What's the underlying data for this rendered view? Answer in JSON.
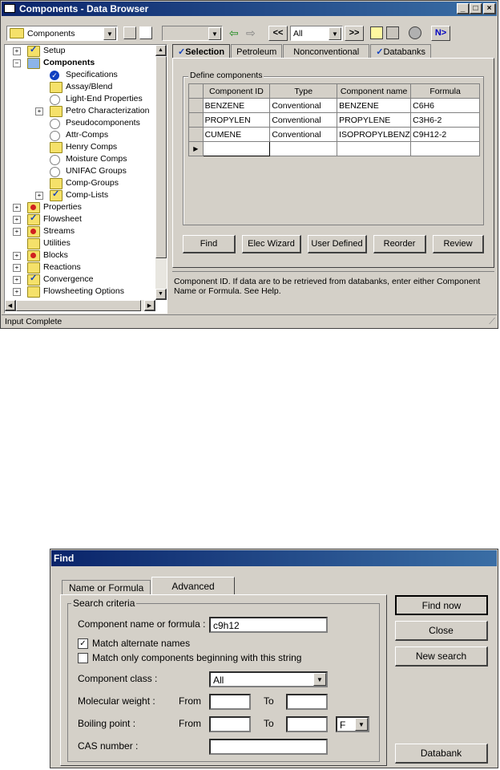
{
  "browser": {
    "title": "Components - Data Browser",
    "window_controls": [
      "_",
      "□",
      "×"
    ],
    "toolbar": {
      "form_select": "Components",
      "nav_select": "All",
      "prev_label": "<<",
      "next_label": ">>",
      "next_form_label": "N>"
    },
    "tree": [
      {
        "label": "Setup",
        "level": 0,
        "expander": "+",
        "icon": "check-folder-icon",
        "bold": false
      },
      {
        "label": "Components",
        "level": 0,
        "expander": "−",
        "icon": "components-folder-icon",
        "bold": true
      },
      {
        "label": "Specifications",
        "level": 1,
        "expander": "",
        "icon": "check-circle-icon",
        "bold": false
      },
      {
        "label": "Assay/Blend",
        "level": 1,
        "expander": "",
        "icon": "folder-icon",
        "bold": false
      },
      {
        "label": "Light-End Properties",
        "level": 1,
        "expander": "",
        "icon": "empty-circle-icon",
        "bold": false
      },
      {
        "label": "Petro Characterization",
        "level": 1,
        "expander": "+",
        "icon": "folder-icon",
        "bold": false
      },
      {
        "label": "Pseudocomponents",
        "level": 1,
        "expander": "",
        "icon": "empty-circle-icon",
        "bold": false
      },
      {
        "label": "Attr-Comps",
        "level": 1,
        "expander": "",
        "icon": "empty-circle-icon",
        "bold": false
      },
      {
        "label": "Henry Comps",
        "level": 1,
        "expander": "",
        "icon": "folder-icon",
        "bold": false
      },
      {
        "label": "Moisture Comps",
        "level": 1,
        "expander": "",
        "icon": "empty-circle-icon",
        "bold": false
      },
      {
        "label": "UNIFAC Groups",
        "level": 1,
        "expander": "",
        "icon": "empty-circle-icon",
        "bold": false
      },
      {
        "label": "Comp-Groups",
        "level": 1,
        "expander": "",
        "icon": "folder-icon",
        "bold": false
      },
      {
        "label": "Comp-Lists",
        "level": 1,
        "expander": "+",
        "icon": "check-folder-icon",
        "bold": false
      },
      {
        "label": "Properties",
        "level": 0,
        "expander": "+",
        "icon": "red-folder-icon",
        "bold": false
      },
      {
        "label": "Flowsheet",
        "level": 0,
        "expander": "+",
        "icon": "check-folder-icon",
        "bold": false
      },
      {
        "label": "Streams",
        "level": 0,
        "expander": "+",
        "icon": "red-folder-icon",
        "bold": false
      },
      {
        "label": "Utilities",
        "level": 0,
        "expander": "",
        "icon": "folder-icon",
        "bold": false
      },
      {
        "label": "Blocks",
        "level": 0,
        "expander": "+",
        "icon": "red-folder-icon",
        "bold": false
      },
      {
        "label": "Reactions",
        "level": 0,
        "expander": "+",
        "icon": "folder-icon",
        "bold": false
      },
      {
        "label": "Convergence",
        "level": 0,
        "expander": "+",
        "icon": "check-folder-icon",
        "bold": false
      },
      {
        "label": "Flowsheeting Options",
        "level": 0,
        "expander": "+",
        "icon": "folder-icon",
        "bold": false
      }
    ],
    "tabs": [
      {
        "label": "Selection",
        "checked": true,
        "active": true
      },
      {
        "label": "Petroleum",
        "checked": false,
        "active": false
      },
      {
        "label": "Nonconventional",
        "checked": false,
        "active": false
      },
      {
        "label": "Databanks",
        "checked": true,
        "active": false
      }
    ],
    "group_label": "Define components",
    "columns": [
      "Component ID",
      "Type",
      "Component name",
      "Formula"
    ],
    "rows": [
      [
        "BENZENE",
        "Conventional",
        "BENZENE",
        "C6H6"
      ],
      [
        "PROPYLEN",
        "Conventional",
        "PROPYLENE",
        "C3H6-2"
      ],
      [
        "CUMENE",
        "Conventional",
        "ISOPROPYLBENZENE",
        "C9H12-2"
      ],
      [
        "",
        "",
        "",
        ""
      ]
    ],
    "buttons": [
      "Find",
      "Elec Wizard",
      "User Defined",
      "Reorder",
      "Review"
    ],
    "help_text": "Component ID. If data are to be retrieved from databanks, enter either Component Name or Formula. See Help.",
    "status": "Input Complete"
  },
  "find": {
    "title": "Find",
    "tabs": [
      {
        "label": "Name or Formula",
        "active": false
      },
      {
        "label": "Advanced",
        "active": true
      }
    ],
    "group_label": "Search criteria",
    "name_label": "Component name or formula :",
    "name_value": "c9h12",
    "match_alternate_label": "Match alternate names",
    "match_alternate_checked": true,
    "match_begin_label": "Match only components beginning with this string",
    "match_begin_checked": false,
    "class_label": "Component class :",
    "class_value": "All",
    "mw_label": "Molecular weight :",
    "bp_label": "Boiling point :",
    "from_label": "From",
    "to_label": "To",
    "bp_unit": "F",
    "cas_label": "CAS number :",
    "buttons": {
      "find_now": "Find now",
      "close": "Close",
      "new_search": "New search",
      "databank": "Databank"
    }
  }
}
